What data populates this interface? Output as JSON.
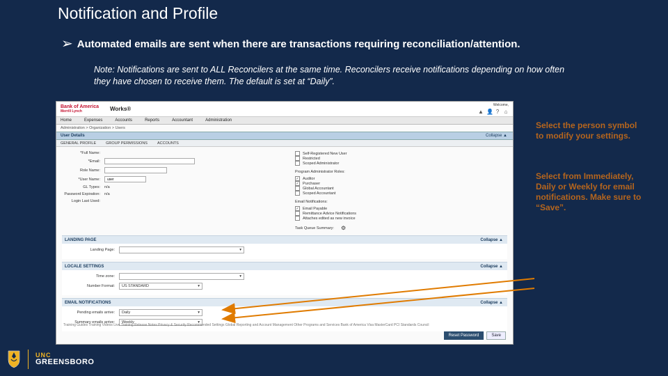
{
  "title": "Notification and Profile",
  "bullet": "Automated emails are sent when there are transactions requiring reconciliation/attention.",
  "note": "Note:  Notifications are sent to ALL Reconcilers at the same time.  Reconcilers receive notifications depending on how often they have chosen to receive them.  The default is set at “Daily”.",
  "callouts": {
    "c1": "Select the person symbol to modify your settings.",
    "c2": "Select from Immediately, Daily or Weekly for email notifications. Make sure to “Save”."
  },
  "app": {
    "brand_line1": "Bank of America",
    "brand_line2": "Merrill Lynch",
    "product": "Works®",
    "welcome": "Welcome,",
    "nav": [
      "Home",
      "Expenses",
      "Accounts",
      "Reports",
      "Accountant",
      "Administration"
    ],
    "crumb": "Administration  >  Organization  >  Users",
    "subtab_title": "User Details",
    "subtab_exp": "Collapse ▲",
    "tabs2": [
      "GENERAL PROFILE",
      "GROUP PERMISSIONS",
      "ACCOUNTS"
    ],
    "left": {
      "name_lbl": "*Full Name:",
      "name_val": "",
      "email_lbl": "*Email:",
      "email_width": 130,
      "role_lbl": "Role Name:",
      "user_lbl": "*User Name:",
      "user_val": "user",
      "gltype_lbl": "GL Types:",
      "gltype_val": "n/a",
      "pwdexp_lbl": "Password Expiration:",
      "pwdexp_val": "n/a",
      "lastlogin_lbl": "Login Last Used:"
    },
    "right": {
      "newuser_lbl": "Self-Registered New User",
      "restrict_lbl": "Restricted",
      "scoped_lbl": "Scoped Administrator",
      "roles_hdr": "Program Administrator Roles:",
      "roles": [
        "Auditor",
        "Purchaser",
        "Global Accountant",
        "Scoped Accountant"
      ],
      "emailnotif_hdr": "Email Notifications:",
      "en1": "Email Payable",
      "en1_check": true,
      "en2": "Remittance Advice Notifications",
      "en2_check": false,
      "en3": "Attaches edited as new invoice",
      "en3_check": false,
      "taskqueue_lbl": "Task Queue Summary:",
      "taskqueue_icon": "⚙"
    },
    "sec_landing": {
      "hdr": "LANDING PAGE",
      "exp": "Collapse ▲",
      "lbl": "Landing Page:"
    },
    "sec_locale": {
      "hdr": "LOCALE SETTINGS",
      "exp": "Collapse ▲",
      "tz_lbl": "Time zone:",
      "num_lbl": "Number Format:",
      "num_val": "US STANDARD"
    },
    "sec_email": {
      "hdr": "EMAIL NOTIFICATIONS",
      "exp": "Collapse ▲",
      "pend_lbl": "Pending emails arrive:",
      "pend_val": "Daily",
      "summ_lbl": "Summary emails arrive:",
      "summ_val": "Weekly"
    },
    "disclaimer": "Training Guides   Training Videos   Live Training   Release Notes   Privacy & Security   Recommended Settings   Global Reporting and Account Management   Other Programs and Services   Bank of America   Visa   MasterCard   PCI Standards Council",
    "buttons": {
      "reset": "Reset Password",
      "save": "Save"
    }
  },
  "logo": {
    "unc": "UNC",
    "greensboro": "GREENSBORO"
  }
}
